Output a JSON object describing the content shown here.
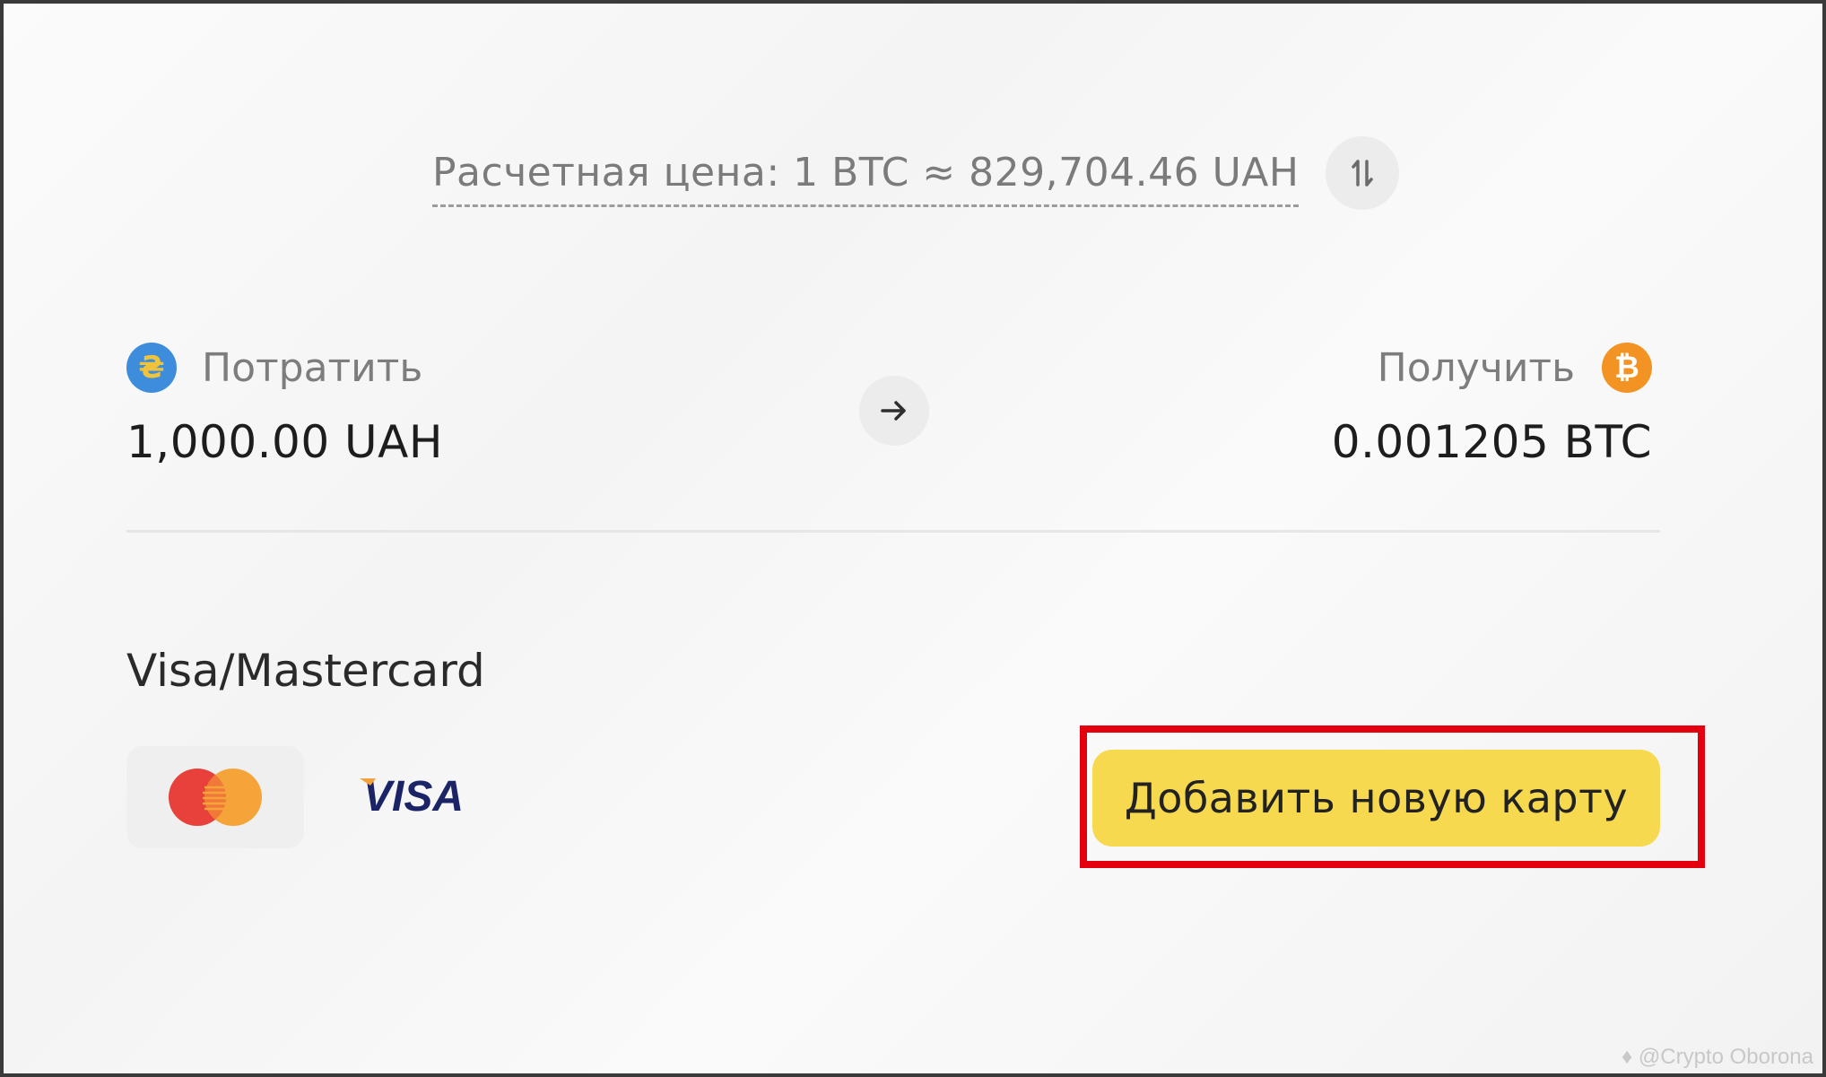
{
  "rate": {
    "text": "Расчетная цена: 1 BTC ≈ 829,704.46 UAH"
  },
  "spend": {
    "label": "Потратить",
    "amount": "1,000.00 UAH"
  },
  "receive": {
    "label": "Получить",
    "amount": "0.001205 BTC"
  },
  "payment": {
    "method_title": "Visa/Mastercard",
    "brands": [
      "mastercard-logo",
      "visa-logo"
    ],
    "visa_text": "VISA",
    "add_card_label": "Добавить новую карту"
  },
  "watermark": {
    "text": "@Crypto Oborona"
  },
  "colors": {
    "accent_yellow": "#f6d94e",
    "highlight_red": "#e5000f",
    "uah_blue": "#3d8ddc",
    "btc_orange": "#f39324"
  },
  "icons": {
    "swap": "swap-vertical-icon",
    "arrow": "arrow-right-icon",
    "uah": "uah-coin-icon",
    "btc": "btc-coin-icon"
  }
}
